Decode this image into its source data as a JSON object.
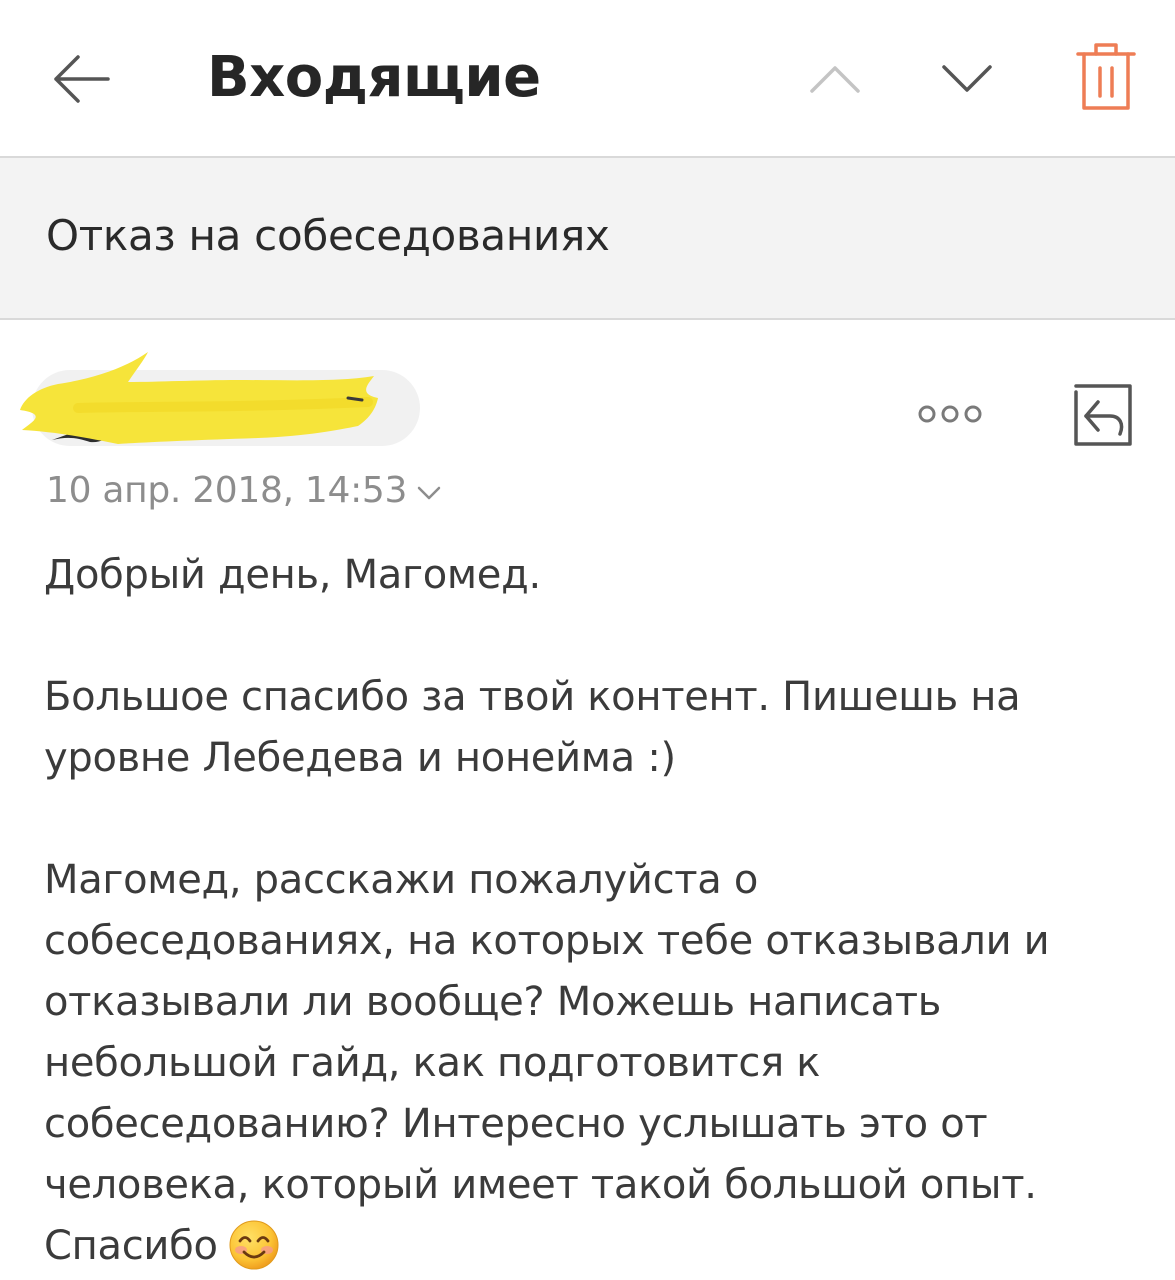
{
  "header": {
    "title": "Входящие",
    "back_icon": "arrow-left-icon",
    "prev_icon": "chevron-up-icon",
    "next_icon": "chevron-down-icon",
    "trash_icon": "trash-icon",
    "accent_color": "#ee7d55"
  },
  "message": {
    "subject": "Отказ на собеседованиях",
    "sender": "",
    "date": "10 апр. 2018, 14:53",
    "more_icon": "more-dots-icon",
    "reply_icon": "reply-icon",
    "body": {
      "greeting": "Добрый день, Магомед.",
      "thanks": "Большое спасибо за твой контент. Пишешь на\nуровне Лебедева и нонейма :)",
      "question": "Магомед, расскажи пожалуйста о\nсобеседованиях, на которых тебе отказывали и\nотказывали ли вообще? Можешь написать\nнебольшой гайд, как подготовится к\nсобеседованию? Интересно услышать это от\nчеловека, который имеет такой большой опыт.\nСпасибо",
      "emoji": "smiling-face-emoji"
    }
  }
}
